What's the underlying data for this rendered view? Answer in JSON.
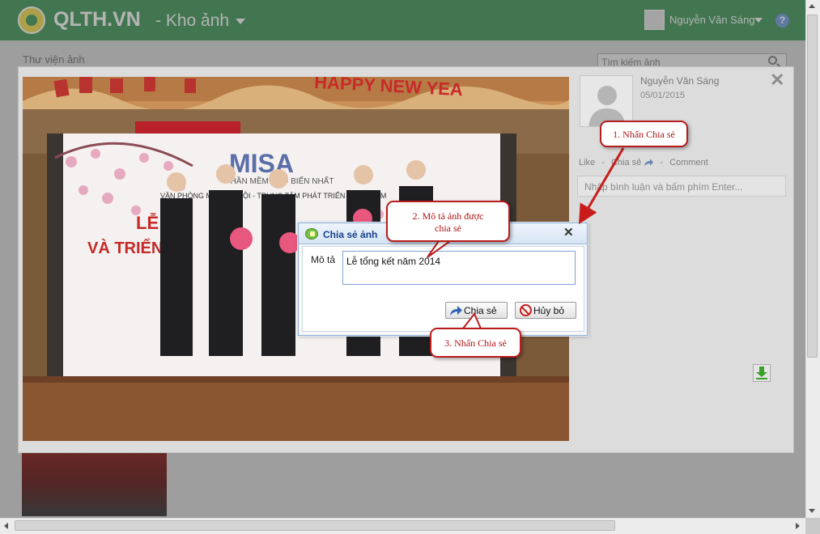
{
  "header": {
    "app_name": "QLTH.VN",
    "module": "- Kho ảnh",
    "user_name": "Nguyễn Văn Sáng",
    "help": "?"
  },
  "page": {
    "title": "Thư viện ảnh",
    "search_placeholder": "Tìm kiếm ảnh"
  },
  "viewer": {
    "user_name": "Nguyễn Văn Sáng",
    "date": "05/01/2015",
    "actions": {
      "like": "Like",
      "sep": "-",
      "share": "Chia sẻ",
      "comment": "Comment"
    },
    "comment_placeholder": "Nhập bình luận và bấm phím Enter..."
  },
  "dialog": {
    "title": "Chia sẻ ảnh",
    "desc_label": "Mô tả",
    "desc_value": "Lễ tổng kết năm 2014",
    "share_button": "Chia sẻ",
    "cancel_button": "Hủy bỏ"
  },
  "callouts": {
    "step1": "1. Nhấn Chia sẻ",
    "step2_line1": "2. Mô tả ảnh được",
    "step2_line2": "chia sẻ",
    "step3": "3. Nhấn Chia sẻ"
  },
  "photo": {
    "logo": "MISA",
    "banner_top": "PHẦN MỀM PHỔ BIẾN NHẤT",
    "banner_sub": "VĂN PHÒNG MISA HÀ NỘI - TRUNG TÂM PHÁT TRIỂN PHẦN MỀM",
    "banner_left1": "LỄ",
    "banner_left2": "VÀ TRIỂN",
    "top_decoration": "HAPPY NEW YEA"
  },
  "colors": {
    "header_green": "#3b8f52",
    "callout_red": "#b81c1c",
    "dialog_title_blue": "#15428b"
  }
}
